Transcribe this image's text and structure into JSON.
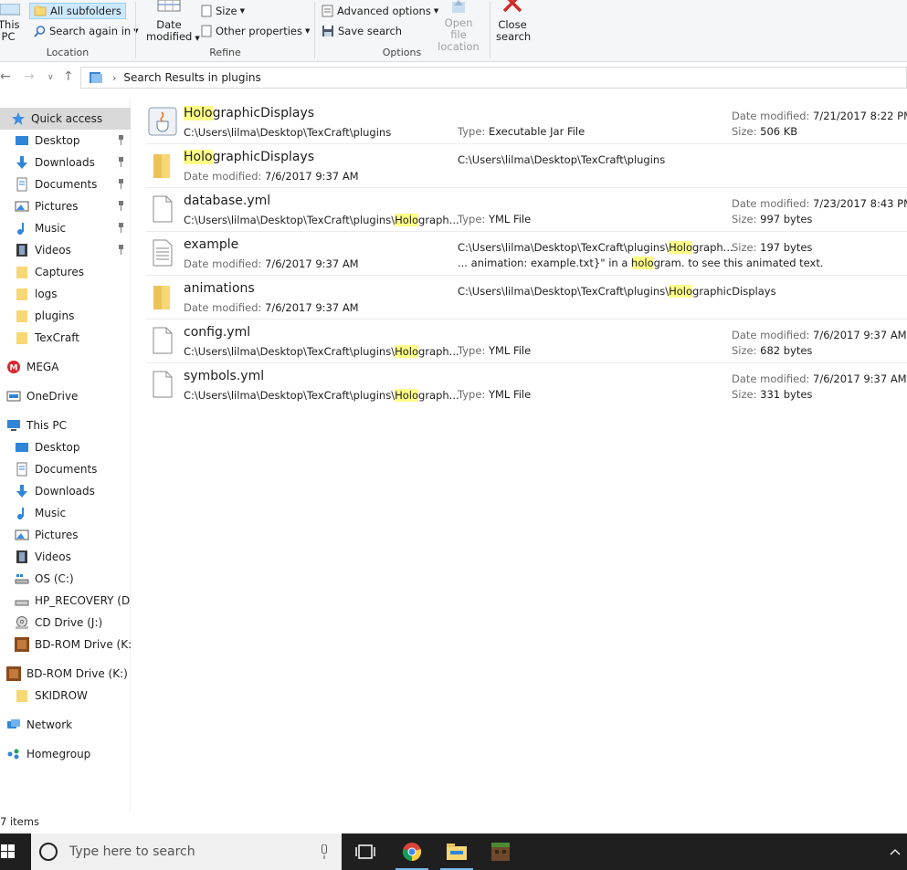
{
  "ribbon": {
    "this_pc": "This PC",
    "all_subfolders": "All subfolders",
    "search_again_in": "Search again in",
    "location_group": "Location",
    "date_modified": "Date modified",
    "size": "Size",
    "other_properties": "Other properties",
    "refine_group": "Refine",
    "advanced_options": "Advanced options",
    "save_search": "Save search",
    "open_file_location": "Open file location",
    "options_group": "Options",
    "close_search": "Close search"
  },
  "address": {
    "path": "Search Results in plugins"
  },
  "nav": {
    "items": [
      {
        "label": "Quick access"
      },
      {
        "label": "Desktop"
      },
      {
        "label": "Downloads"
      },
      {
        "label": "Documents"
      },
      {
        "label": "Pictures"
      },
      {
        "label": "Music"
      },
      {
        "label": "Videos"
      },
      {
        "label": "Captures"
      },
      {
        "label": "logs"
      },
      {
        "label": "plugins"
      },
      {
        "label": "TexCraft"
      },
      {
        "label": "MEGA"
      },
      {
        "label": "OneDrive"
      },
      {
        "label": "This PC"
      },
      {
        "label": "Desktop"
      },
      {
        "label": "Documents"
      },
      {
        "label": "Downloads"
      },
      {
        "label": "Music"
      },
      {
        "label": "Pictures"
      },
      {
        "label": "Videos"
      },
      {
        "label": "OS (C:)"
      },
      {
        "label": "HP_RECOVERY (D:)"
      },
      {
        "label": "CD Drive (J:)"
      },
      {
        "label": "BD-ROM Drive (K:) C"
      },
      {
        "label": "BD-ROM Drive (K:) Co"
      },
      {
        "label": "SKIDROW"
      },
      {
        "label": "Network"
      },
      {
        "label": "Homegroup"
      }
    ]
  },
  "labels": {
    "date_modified": "Date modified:",
    "type": "Type:",
    "size": "Size:"
  },
  "results": [
    {
      "name_hl": "Holo",
      "name_rest": "graphicDisplays",
      "path": "C:\\Users\\lilma\\Desktop\\TexCraft\\plugins",
      "type": "Executable Jar File",
      "date": "7/21/2017 8:22 PM",
      "size": "506 KB"
    },
    {
      "name_hl": "Holo",
      "name_rest": "graphicDisplays",
      "date": "7/6/2017 9:37 AM",
      "location": "C:\\Users\\lilma\\Desktop\\TexCraft\\plugins"
    },
    {
      "name": "database.yml",
      "path_pre": "C:\\Users\\lilma\\Desktop\\TexCraft\\plugins\\",
      "path_hl": "Holo",
      "path_post": "graph...",
      "type": "YML File",
      "date": "7/23/2017 8:43 PM",
      "size": "997 bytes"
    },
    {
      "name": "example",
      "date": "7/6/2017 9:37 AM",
      "loc_pre": "C:\\Users\\lilma\\Desktop\\TexCraft\\plugins\\",
      "loc_hl": "Holo",
      "loc_post": "graph...",
      "size": "197 bytes",
      "snippet_pre": "... animation: example.txt}\" in a ",
      "snippet_hl": "holo",
      "snippet_post": "gram. to see this animated text."
    },
    {
      "name": "animations",
      "date": "7/6/2017 9:37 AM",
      "loc_pre": "C:\\Users\\lilma\\Desktop\\TexCraft\\plugins\\",
      "loc_hl": "Holo",
      "loc_post": "graphicDisplays"
    },
    {
      "name": "config.yml",
      "path_pre": "C:\\Users\\lilma\\Desktop\\TexCraft\\plugins\\",
      "path_hl": "Holo",
      "path_post": "graph...",
      "type": "YML File",
      "date": "7/6/2017 9:37 AM",
      "size": "682 bytes"
    },
    {
      "name": "symbols.yml",
      "path_pre": "C:\\Users\\lilma\\Desktop\\TexCraft\\plugins\\",
      "path_hl": "Holo",
      "path_post": "graph...",
      "type": "YML File",
      "date": "7/6/2017 9:37 AM",
      "size": "331 bytes"
    }
  ],
  "status": {
    "count": "7 items"
  },
  "taskbar": {
    "search_placeholder": "Type here to search"
  },
  "colors": {
    "highlight": "#ffff88",
    "selection": "#cce8ff",
    "taskbar": "#1f1f1f"
  }
}
